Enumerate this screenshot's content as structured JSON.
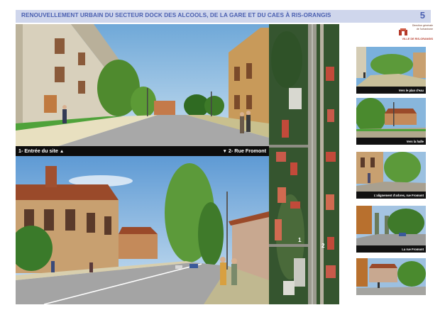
{
  "header": {
    "title": "RENOUVELLEMENT URBAIN DU SECTEUR DOCK DES ALCOOLS, DE LA GARE ET DU CAES À RIS-ORANGIS",
    "page_number": "5"
  },
  "logo": {
    "line1": "Direction générale",
    "line2": "de l'urbanisme",
    "line3": "VILLE DE RIS-ORANGIS"
  },
  "captions": {
    "left": "1- Entrée du site",
    "right": "2- Rue Fromont",
    "up_arrow": "▲",
    "down_arrow": "▼"
  },
  "map": {
    "marker_1": "1",
    "marker_2": "2"
  },
  "thumbnails": [
    {
      "caption": "Vers le plan d'eau"
    },
    {
      "caption": "Vers la halle"
    },
    {
      "caption": "L'alignement d'arbres, rue Fromont"
    },
    {
      "caption": "La rue Fromont"
    },
    {
      "caption": ""
    }
  ],
  "colors": {
    "header_bg": "#cfd6ec",
    "header_text": "#4a5fb0",
    "panel_bg": "#111111"
  }
}
